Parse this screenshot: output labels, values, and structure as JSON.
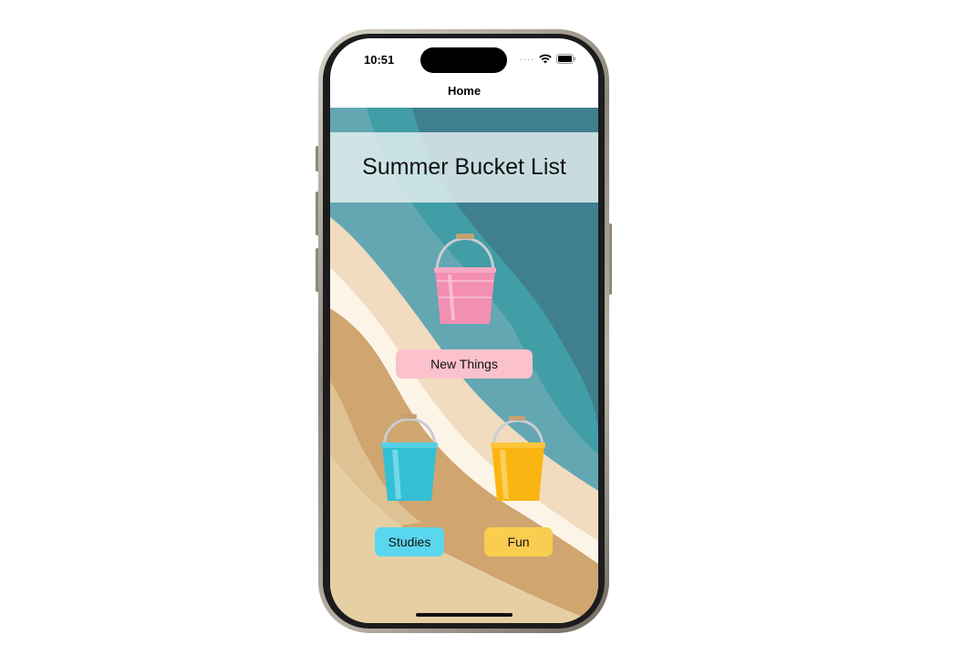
{
  "status_bar": {
    "time": "10:51"
  },
  "nav": {
    "title": "Home"
  },
  "header": {
    "title": "Summer Bucket List"
  },
  "buckets": [
    {
      "label": "New Things",
      "color": "#f38fb3",
      "button_color": "#fbc1cc"
    },
    {
      "label": "Studies",
      "color": "#33bfd6",
      "button_color": "#5ad7ee"
    },
    {
      "label": "Fun",
      "color": "#fbb512",
      "button_color": "#f9cd4f"
    }
  ],
  "colors": {
    "sea_deep": "#3f7f8f",
    "sea": "#419da6",
    "sea_light": "#63a7b3",
    "sand_light": "#f1dcc0",
    "sand": "#d0a56f",
    "sand_pale": "#e6cfa3",
    "foam": "#fdf4e8"
  }
}
